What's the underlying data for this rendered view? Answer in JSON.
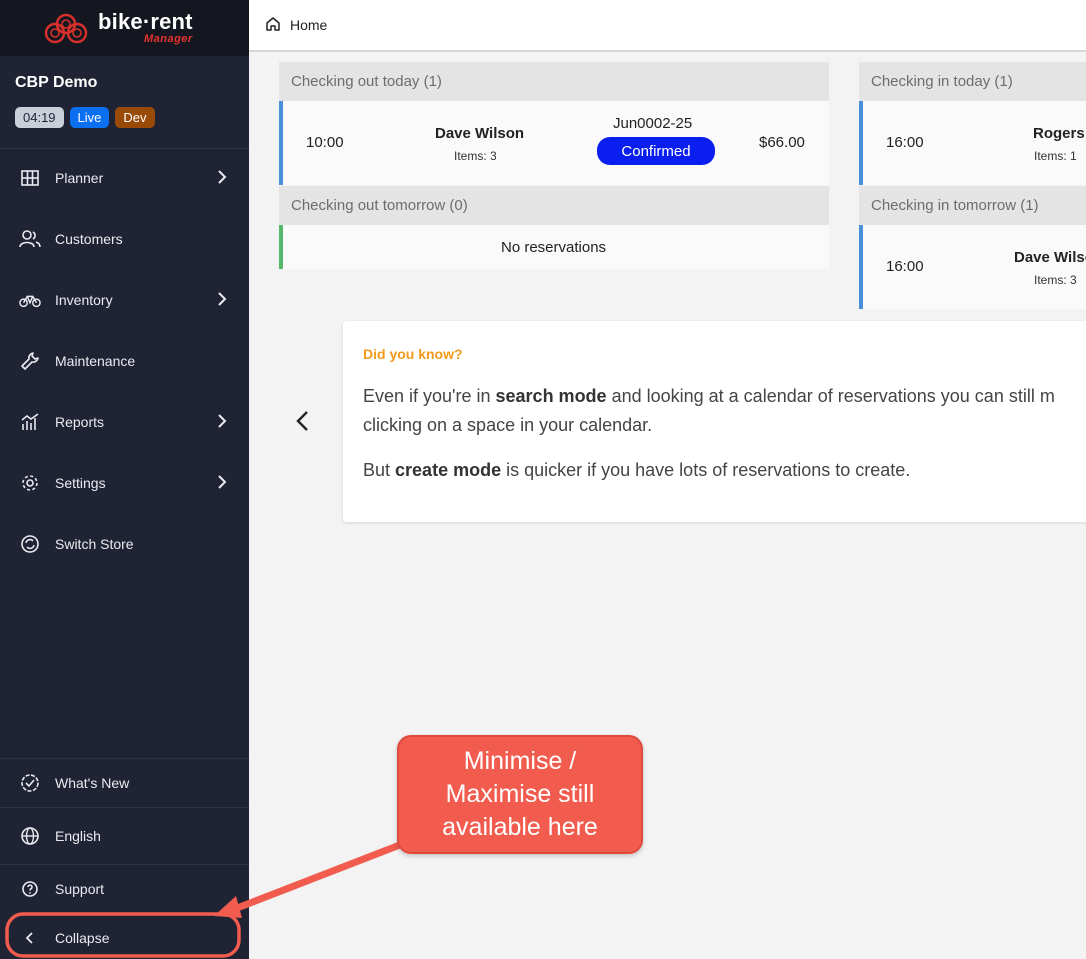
{
  "app": {
    "logo_main": "bike·rent",
    "logo_sub": "Manager"
  },
  "store": {
    "name": "CBP Demo",
    "time": "04:19",
    "live_badge": "Live",
    "dev_badge": "Dev"
  },
  "nav": {
    "planner": "Planner",
    "customers": "Customers",
    "inventory": "Inventory",
    "maintenance": "Maintenance",
    "reports": "Reports",
    "settings": "Settings",
    "switch_store": "Switch Store",
    "whats_new": "What's New",
    "english": "English",
    "support": "Support",
    "collapse": "Collapse"
  },
  "topbar": {
    "home": "Home"
  },
  "checkout_today": {
    "header": "Checking out today (1)",
    "time": "10:00",
    "name": "Dave Wilson",
    "items": "Items: 3",
    "ref": "Jun0002-25",
    "status": "Confirmed",
    "price": "$66.00"
  },
  "checkout_tomorrow": {
    "header": "Checking out tomorrow (0)",
    "empty": "No reservations"
  },
  "checkin_today": {
    "header": "Checking in today (1)",
    "time": "16:00",
    "name": "Rogers",
    "items": "Items: 1"
  },
  "checkin_tomorrow": {
    "header": "Checking in tomorrow (1)",
    "time": "16:00",
    "name": "Dave Wilso",
    "items": "Items: 3"
  },
  "tip": {
    "title": "Did you know?",
    "line1_pre": "Even if you're in ",
    "line1_bold": "search mode",
    "line1_post": " and looking at a calendar of reservations you can still m",
    "line2": "clicking on a space in your calendar.",
    "line3_pre": "But ",
    "line3_bold": "create mode",
    "line3_post": " is quicker if you have lots of reservations to create."
  },
  "callout": {
    "line1": "Minimise /",
    "line2": "Maximise still",
    "line3": "available here"
  },
  "colors": {
    "sidebar_bg": "#1f2333",
    "accent_blue": "#0b1ef0",
    "tip_title": "#f29a1a",
    "callout_bg": "#f25c4e"
  }
}
